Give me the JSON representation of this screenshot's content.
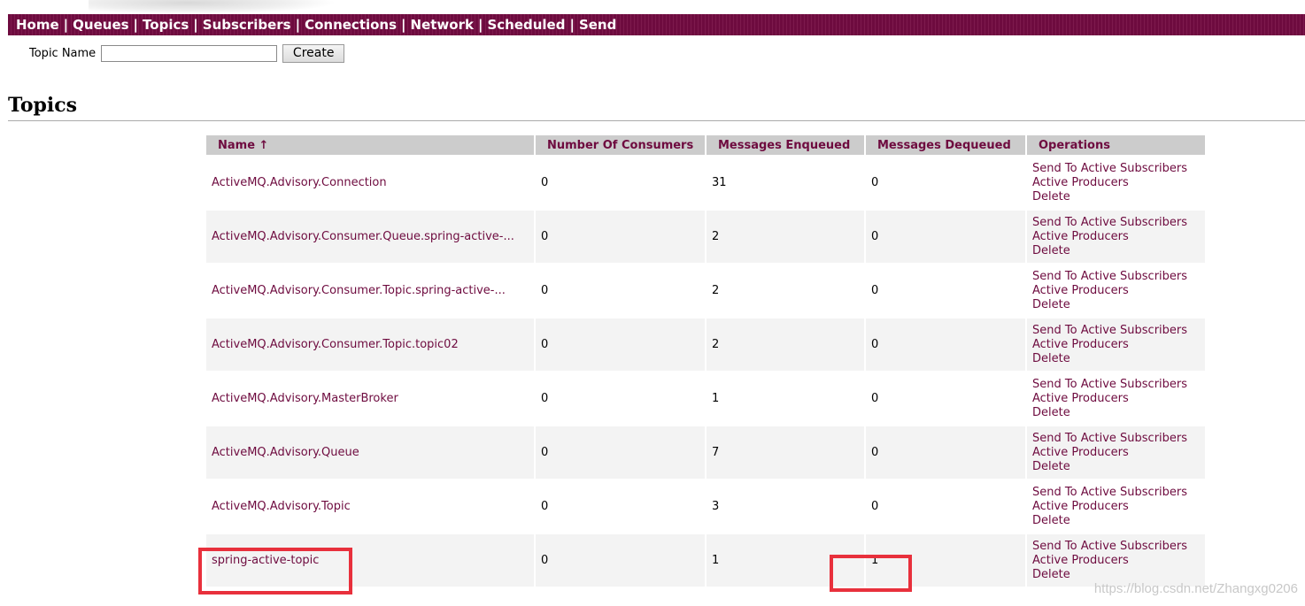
{
  "nav": {
    "items": [
      "Home",
      "Queues",
      "Topics",
      "Subscribers",
      "Connections",
      "Network",
      "Scheduled",
      "Send"
    ],
    "separator": "|"
  },
  "create_form": {
    "label": "Topic Name",
    "input_value": "",
    "button_label": "Create"
  },
  "page_title": "Topics",
  "table": {
    "headers": {
      "name": "Name ↑",
      "consumers": "Number Of Consumers",
      "enqueued": "Messages Enqueued",
      "dequeued": "Messages Dequeued",
      "operations": "Operations"
    },
    "operations": [
      "Send To Active Subscribers",
      "Active Producers",
      "Delete"
    ],
    "rows": [
      {
        "name": "ActiveMQ.Advisory.Connection",
        "consumers": "0",
        "enqueued": "31",
        "dequeued": "0"
      },
      {
        "name": "ActiveMQ.Advisory.Consumer.Queue.spring-active-...",
        "consumers": "0",
        "enqueued": "2",
        "dequeued": "0"
      },
      {
        "name": "ActiveMQ.Advisory.Consumer.Topic.spring-active-...",
        "consumers": "0",
        "enqueued": "2",
        "dequeued": "0"
      },
      {
        "name": "ActiveMQ.Advisory.Consumer.Topic.topic02",
        "consumers": "0",
        "enqueued": "2",
        "dequeued": "0"
      },
      {
        "name": "ActiveMQ.Advisory.MasterBroker",
        "consumers": "0",
        "enqueued": "1",
        "dequeued": "0"
      },
      {
        "name": "ActiveMQ.Advisory.Queue",
        "consumers": "0",
        "enqueued": "7",
        "dequeued": "0"
      },
      {
        "name": "ActiveMQ.Advisory.Topic",
        "consumers": "0",
        "enqueued": "3",
        "dequeued": "0"
      },
      {
        "name": "spring-active-topic",
        "consumers": "0",
        "enqueued": "1",
        "dequeued": "1"
      }
    ]
  },
  "watermark": "https://blog.csdn.net/Zhangxg0206",
  "colors": {
    "brand": "#6e0b3f",
    "header_bg": "#cccccc",
    "highlight": "#e8303c"
  }
}
